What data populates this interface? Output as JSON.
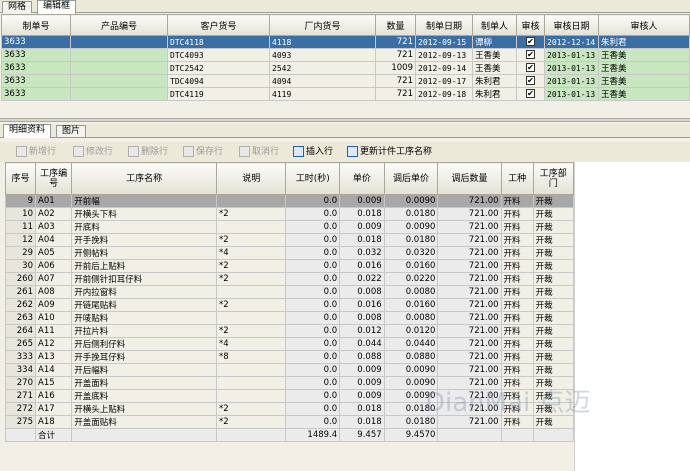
{
  "top_tabs": [
    "网格",
    "编辑框"
  ],
  "orders": {
    "headers": [
      "制单号",
      "产品编号",
      "客户货号",
      "厂内货号",
      "数量",
      "制单日期",
      "制单人",
      "审核",
      "审核日期",
      "审核人"
    ],
    "rows": [
      {
        "order_no": "3633",
        "product_no": "",
        "customer_no": "DTC4118",
        "factory_no": "4118",
        "qty": "721",
        "date": "2012-09-15",
        "maker": "谭柳",
        "approved": "✔",
        "approve_date": "2012-12-14",
        "approver": "朱利君"
      },
      {
        "order_no": "3633",
        "product_no": "",
        "customer_no": "DTC4093",
        "factory_no": "4093",
        "qty": "721",
        "date": "2012-09-13",
        "maker": "王香美",
        "approved": "✔",
        "approve_date": "2013-01-13",
        "approver": "王香美"
      },
      {
        "order_no": "3633",
        "product_no": "",
        "customer_no": "DTC2542",
        "factory_no": "2542",
        "qty": "1009",
        "date": "2012-09-14",
        "maker": "王香美",
        "approved": "✔",
        "approve_date": "2013-01-13",
        "approver": "王香美"
      },
      {
        "order_no": "3633",
        "product_no": "",
        "customer_no": "TDC4094",
        "factory_no": "4094",
        "qty": "721",
        "date": "2012-09-17",
        "maker": "朱利君",
        "approved": "✔",
        "approve_date": "2013-01-13",
        "approver": "王香美"
      },
      {
        "order_no": "3633",
        "product_no": "",
        "customer_no": "DTC4119",
        "factory_no": "4119",
        "qty": "721",
        "date": "2012-09-18",
        "maker": "朱利君",
        "approved": "✔",
        "approve_date": "2013-01-13",
        "approver": "王香美"
      }
    ]
  },
  "detail_tabs": [
    "明细资料",
    "图片"
  ],
  "toolbar": {
    "add": "新增行",
    "edit": "修改行",
    "delete": "删除行",
    "save": "保存行",
    "cancel": "取消行",
    "insert": "插入行",
    "update": "更新计件工序名称"
  },
  "process": {
    "headers": [
      "序号",
      "工序编号",
      "工序名称",
      "说明",
      "工时(秒)",
      "单价",
      "调后单价",
      "调后数量",
      "工种",
      "工序部门"
    ],
    "rows": [
      {
        "seq": "9",
        "code": "A01",
        "name": "开前幅",
        "note": "",
        "time": "0.0",
        "price": "0.009",
        "adj_price": "0.0090",
        "adj_qty": "721.00",
        "type": "开料",
        "dept": "开裁"
      },
      {
        "seq": "10",
        "code": "A02",
        "name": "开横头下料",
        "note": "*2",
        "time": "0.0",
        "price": "0.018",
        "adj_price": "0.0180",
        "adj_qty": "721.00",
        "type": "开料",
        "dept": "开裁"
      },
      {
        "seq": "11",
        "code": "A03",
        "name": "开底料",
        "note": "",
        "time": "0.0",
        "price": "0.009",
        "adj_price": "0.0090",
        "adj_qty": "721.00",
        "type": "开料",
        "dept": "开裁"
      },
      {
        "seq": "12",
        "code": "A04",
        "name": "开手挽料",
        "note": "*2",
        "time": "0.0",
        "price": "0.018",
        "adj_price": "0.0180",
        "adj_qty": "721.00",
        "type": "开料",
        "dept": "开裁"
      },
      {
        "seq": "29",
        "code": "A05",
        "name": "开侧帖料",
        "note": "*4",
        "time": "0.0",
        "price": "0.032",
        "adj_price": "0.0320",
        "adj_qty": "721.00",
        "type": "开料",
        "dept": "开裁"
      },
      {
        "seq": "30",
        "code": "A06",
        "name": "开前后上贴料",
        "note": "*2",
        "time": "0.0",
        "price": "0.016",
        "adj_price": "0.0160",
        "adj_qty": "721.00",
        "type": "开料",
        "dept": "开裁"
      },
      {
        "seq": "260",
        "code": "A07",
        "name": "开前侧针扣耳仔料",
        "note": "*2",
        "time": "0.0",
        "price": "0.022",
        "adj_price": "0.0220",
        "adj_qty": "721.00",
        "type": "开料",
        "dept": "开裁"
      },
      {
        "seq": "261",
        "code": "A08",
        "name": "开内拉窗料",
        "note": "",
        "time": "0.0",
        "price": "0.008",
        "adj_price": "0.0080",
        "adj_qty": "721.00",
        "type": "开料",
        "dept": "开裁"
      },
      {
        "seq": "262",
        "code": "A09",
        "name": "开链尾贴料",
        "note": "*2",
        "time": "0.0",
        "price": "0.016",
        "adj_price": "0.0160",
        "adj_qty": "721.00",
        "type": "开料",
        "dept": "开裁"
      },
      {
        "seq": "263",
        "code": "A10",
        "name": "开唛贴料",
        "note": "",
        "time": "0.0",
        "price": "0.008",
        "adj_price": "0.0080",
        "adj_qty": "721.00",
        "type": "开料",
        "dept": "开裁"
      },
      {
        "seq": "264",
        "code": "A11",
        "name": "开拉片料",
        "note": "*2",
        "time": "0.0",
        "price": "0.012",
        "adj_price": "0.0120",
        "adj_qty": "721.00",
        "type": "开料",
        "dept": "开裁"
      },
      {
        "seq": "265",
        "code": "A12",
        "name": "开后侧利仔料",
        "note": "*4",
        "time": "0.0",
        "price": "0.044",
        "adj_price": "0.0440",
        "adj_qty": "721.00",
        "type": "开料",
        "dept": "开裁"
      },
      {
        "seq": "333",
        "code": "A13",
        "name": "开手挽耳仔料",
        "note": "*8",
        "time": "0.0",
        "price": "0.088",
        "adj_price": "0.0880",
        "adj_qty": "721.00",
        "type": "开料",
        "dept": "开裁"
      },
      {
        "seq": "334",
        "code": "A14",
        "name": "开后幅料",
        "note": "",
        "time": "0.0",
        "price": "0.009",
        "adj_price": "0.0090",
        "adj_qty": "721.00",
        "type": "开料",
        "dept": "开裁"
      },
      {
        "seq": "270",
        "code": "A15",
        "name": "开盖面料",
        "note": "",
        "time": "0.0",
        "price": "0.009",
        "adj_price": "0.0090",
        "adj_qty": "721.00",
        "type": "开料",
        "dept": "开裁"
      },
      {
        "seq": "271",
        "code": "A16",
        "name": "开盖底料",
        "note": "",
        "time": "0.0",
        "price": "0.009",
        "adj_price": "0.0090",
        "adj_qty": "721.00",
        "type": "开料",
        "dept": "开裁"
      },
      {
        "seq": "272",
        "code": "A17",
        "name": "开横头上贴料",
        "note": "*2",
        "time": "0.0",
        "price": "0.018",
        "adj_price": "0.0180",
        "adj_qty": "721.00",
        "type": "开料",
        "dept": "开裁"
      },
      {
        "seq": "275",
        "code": "A18",
        "name": "开盖面贴料",
        "note": "*2",
        "time": "0.0",
        "price": "0.018",
        "adj_price": "0.0180",
        "adj_qty": "721.00",
        "type": "开料",
        "dept": "开裁"
      }
    ],
    "total_label": "合计",
    "total_time": "1489.4",
    "total_price": "9.457",
    "total_adj_price": "9.4570"
  },
  "watermark": "DianMai 点迈"
}
